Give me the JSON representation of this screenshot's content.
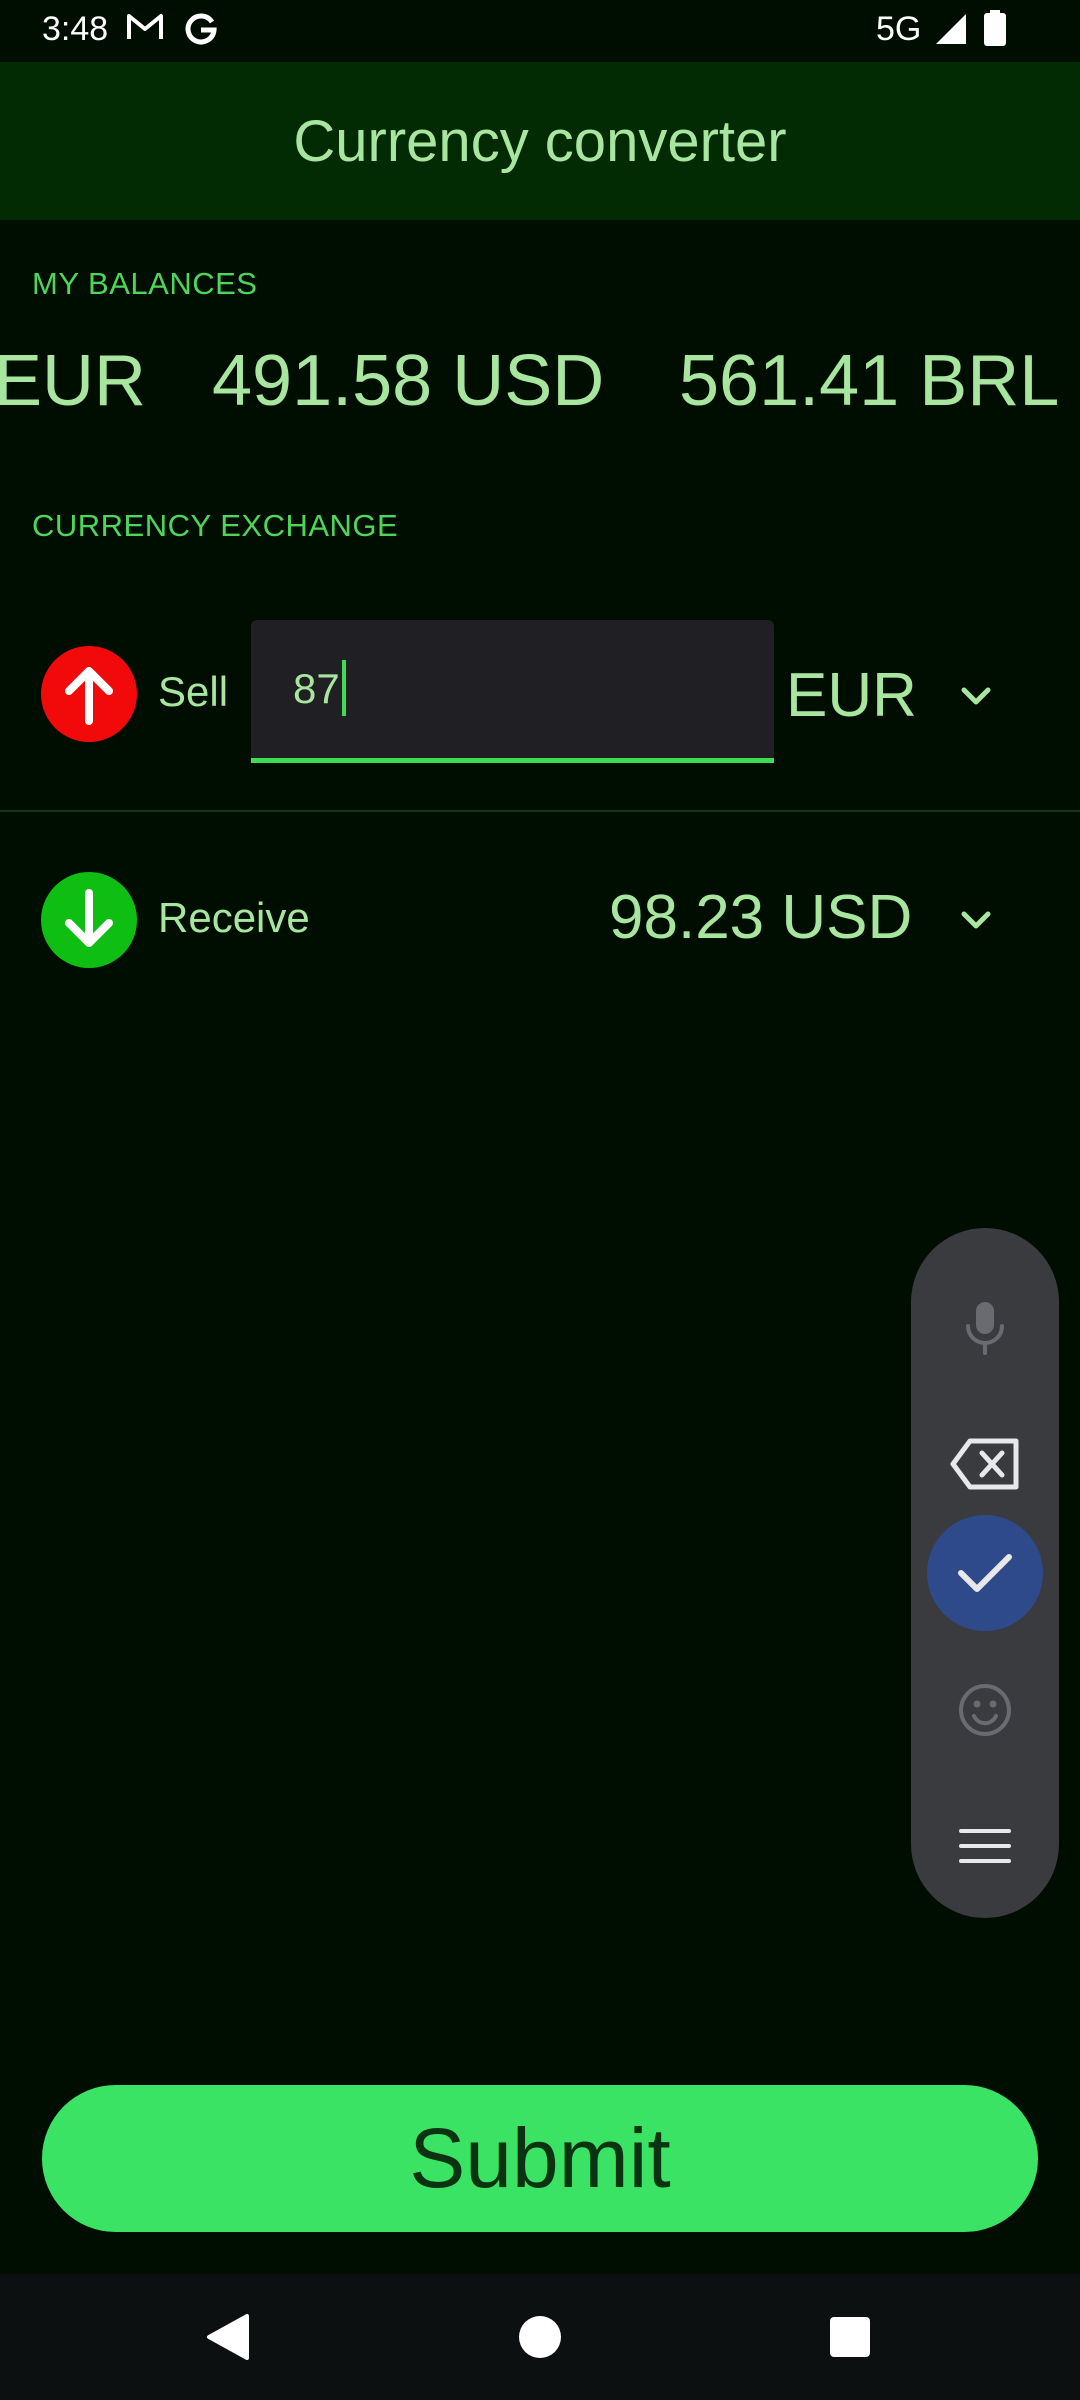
{
  "status_bar": {
    "time": "3:48",
    "network": "5G"
  },
  "app_bar": {
    "title": "Currency converter"
  },
  "balances": {
    "label": "MY BALANCES",
    "items": [
      {
        "text": "EUR"
      },
      {
        "text": "491.58 USD"
      },
      {
        "text": "561.41 BRL"
      }
    ]
  },
  "exchange": {
    "label": "CURRENCY EXCHANGE",
    "sell": {
      "label": "Sell",
      "amount": "87",
      "currency": "EUR"
    },
    "receive": {
      "label": "Receive",
      "amount": "98.23 USD"
    }
  },
  "submit_label": "Submit",
  "colors": {
    "accent": "#3ae364",
    "sell": "#f20a0a",
    "receive": "#0fbe13",
    "text": "#a8e6a0"
  },
  "icons": {
    "sell": "arrow-up-icon",
    "receive": "arrow-down-icon",
    "keyboard": [
      "mic-icon",
      "backspace-icon",
      "check-icon",
      "emoji-icon",
      "menu-icon"
    ]
  }
}
